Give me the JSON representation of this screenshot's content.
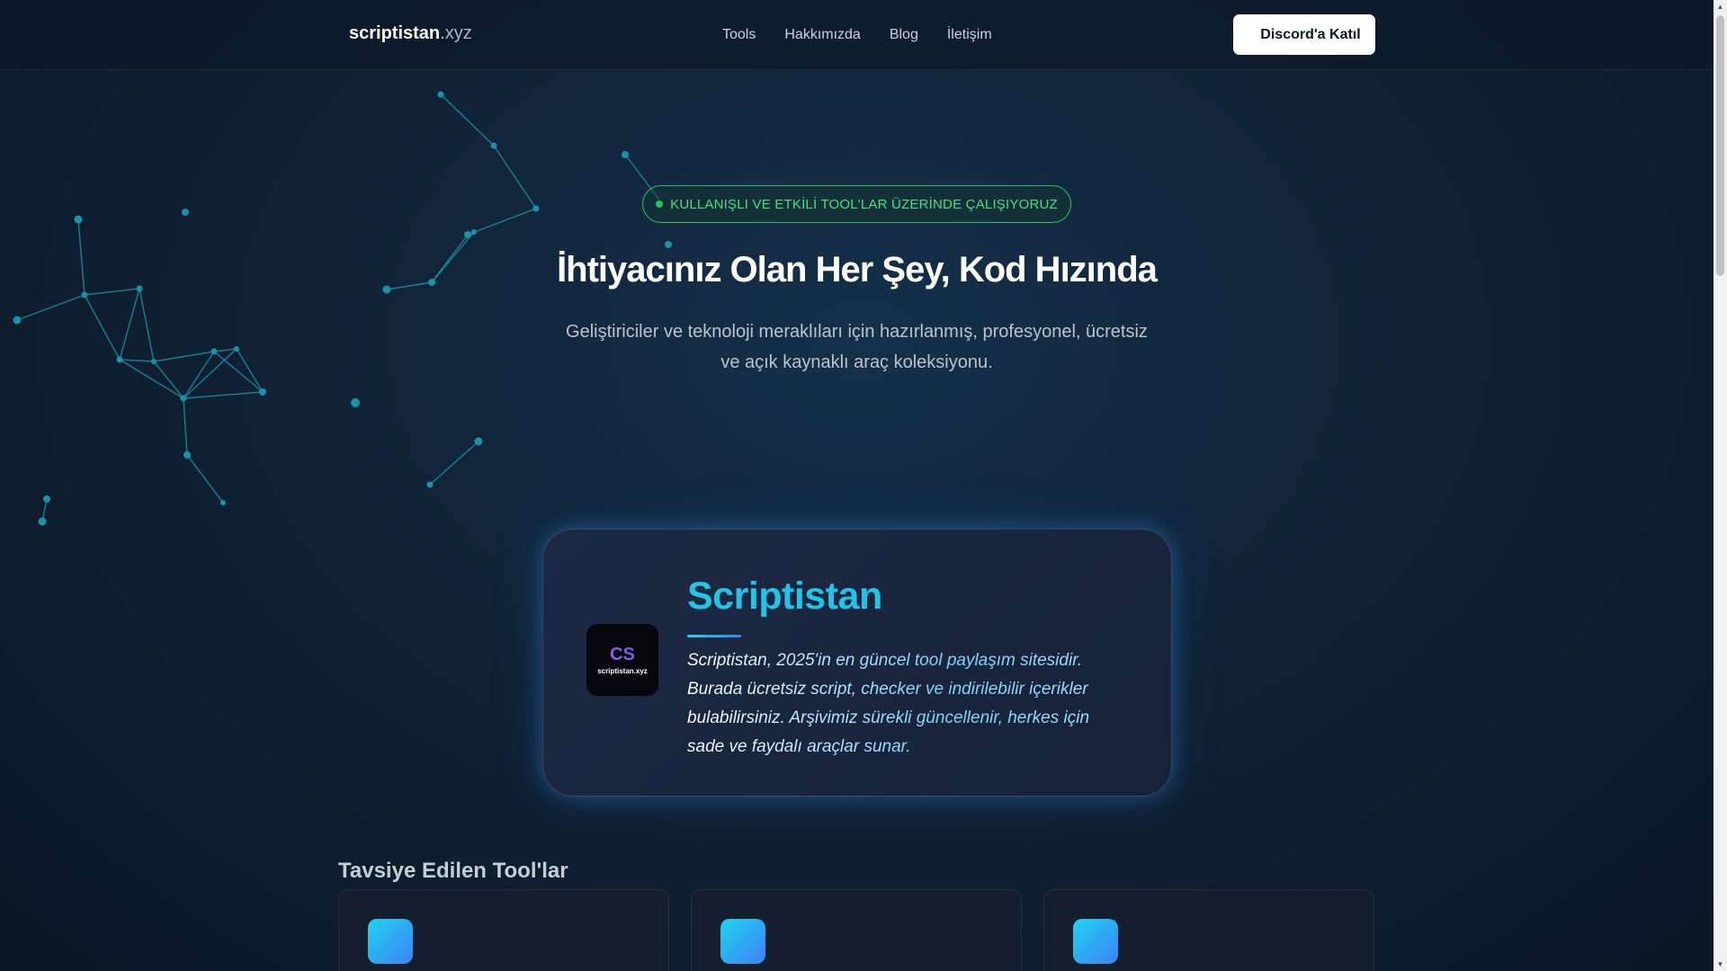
{
  "nav": {
    "brand_name": "scriptistan",
    "brand_tld": ".xyz",
    "links": [
      "Tools",
      "Hakkımızda",
      "Blog",
      "İletişim"
    ],
    "cta_label": "Discord'a Katıl"
  },
  "hero": {
    "badge": "KULLANIŞLI VE ETKİLİ TOOL'LAR ÜZERİNDE ÇALIŞIYORUZ",
    "title": "İhtiyacınız Olan Her Şey, Kod Hızında",
    "subtitle": "Geliştiriciler ve teknoloji meraklıları için hazırlanmış, profesyonel, ücretsiz ve açık kaynaklı araç koleksiyonu."
  },
  "feature": {
    "logo_mark": "CS",
    "logo_text": "scriptistan.xyz",
    "title": "Scriptistan",
    "description": "Scriptistan, 2025'in en güncel tool paylaşım sitesidir. Burada ücretsiz script, checker ve indirilebilir içerikler bulabilirsiniz. Arşivimiz sürekli güncellenir, herkes için sade ve faydalı araçlar sunar."
  },
  "recommended": {
    "title": "Tavsiye Edilen Tool'lar"
  },
  "colors": {
    "accent_cyan": "#22c3e6",
    "badge_green": "#22c55e",
    "background": "#0f1a2a"
  }
}
